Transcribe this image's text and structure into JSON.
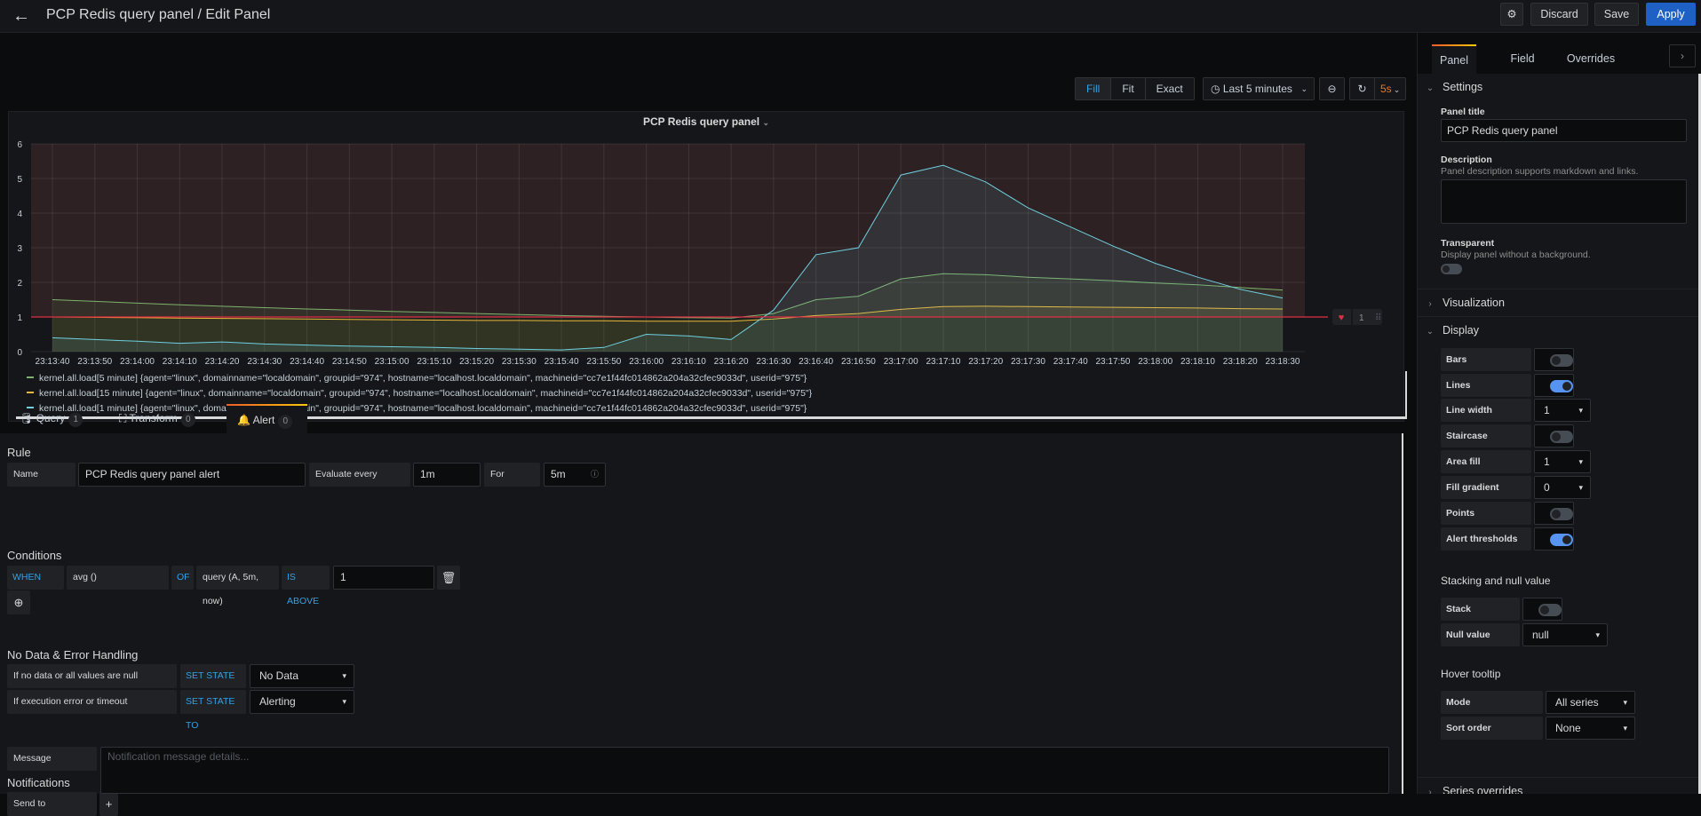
{
  "header": {
    "title": "PCP Redis query panel / Edit Panel",
    "discard_label": "Discard",
    "save_label": "Save",
    "apply_label": "Apply"
  },
  "toolbar": {
    "modes": [
      "Fill",
      "Fit",
      "Exact"
    ],
    "active_mode": "Fill",
    "time_range": "Last 5 minutes",
    "refresh_interval": "5s"
  },
  "panel": {
    "title": "PCP Redis query panel"
  },
  "chart_data": {
    "type": "area",
    "title": "PCP Redis query panel",
    "xlabel": "",
    "ylabel": "",
    "ylim": [
      0,
      6
    ],
    "yticks": [
      "0",
      "1",
      "2",
      "3",
      "4",
      "5",
      "6"
    ],
    "x": [
      "23:13:40",
      "23:13:50",
      "23:14:00",
      "23:14:10",
      "23:14:20",
      "23:14:30",
      "23:14:40",
      "23:14:50",
      "23:15:00",
      "23:15:10",
      "23:15:20",
      "23:15:30",
      "23:15:40",
      "23:15:50",
      "23:16:00",
      "23:16:10",
      "23:16:20",
      "23:16:30",
      "23:16:40",
      "23:16:50",
      "23:17:00",
      "23:17:10",
      "23:17:20",
      "23:17:30",
      "23:17:40",
      "23:17:50",
      "23:18:00",
      "23:18:10",
      "23:18:20",
      "23:18:30"
    ],
    "grid": true,
    "threshold": {
      "value": 1,
      "op": "gt",
      "color": "#e02f44"
    },
    "series": [
      {
        "name": "kernel.all.load[5 minute] {agent=\"linux\", domainname=\"localdomain\", groupid=\"974\", hostname=\"localhost.localdomain\", machineid=\"cc7e1f44fc014862a204a32cfec9033d\", userid=\"975\"}",
        "color": "#7eb26d",
        "values": [
          1.5,
          1.45,
          1.4,
          1.35,
          1.31,
          1.27,
          1.23,
          1.2,
          1.16,
          1.13,
          1.1,
          1.07,
          1.04,
          1.02,
          1.0,
          0.98,
          0.97,
          1.1,
          1.5,
          1.6,
          2.1,
          2.25,
          2.22,
          2.15,
          2.1,
          2.05,
          1.98,
          1.93,
          1.85,
          1.78
        ]
      },
      {
        "name": "kernel.all.load[15 minute] {agent=\"linux\", domainname=\"localdomain\", groupid=\"974\", hostname=\"localhost.localdomain\", machineid=\"cc7e1f44fc014862a204a32cfec9033d\", userid=\"975\"}",
        "color": "#eab839",
        "values": [
          1.0,
          0.99,
          0.98,
          0.97,
          0.96,
          0.95,
          0.94,
          0.93,
          0.92,
          0.91,
          0.9,
          0.9,
          0.89,
          0.89,
          0.88,
          0.88,
          0.88,
          0.94,
          1.04,
          1.1,
          1.22,
          1.3,
          1.31,
          1.3,
          1.29,
          1.28,
          1.27,
          1.26,
          1.24,
          1.23
        ]
      },
      {
        "name": "kernel.all.load[1 minute] {agent=\"linux\", domainname=\"localdomain\", groupid=\"974\", hostname=\"localhost.localdomain\", machineid=\"cc7e1f44fc014862a204a32cfec9033d\", userid=\"975\"}",
        "color": "#6ed0e0",
        "values": [
          0.4,
          0.35,
          0.3,
          0.24,
          0.28,
          0.22,
          0.19,
          0.16,
          0.14,
          0.12,
          0.09,
          0.07,
          0.05,
          0.12,
          0.5,
          0.45,
          0.35,
          1.2,
          2.8,
          3.0,
          5.1,
          5.38,
          4.9,
          4.15,
          3.6,
          3.05,
          2.55,
          2.15,
          1.8,
          1.55
        ]
      }
    ]
  },
  "threshold_handle": {
    "value": "1"
  },
  "editor_tabs": [
    {
      "label": "Query",
      "count": "1"
    },
    {
      "label": "Transform",
      "count": "0"
    },
    {
      "label": "Alert",
      "count": "0"
    }
  ],
  "alert": {
    "rule_title": "Rule",
    "name_label": "Name",
    "name_value": "PCP Redis query panel alert",
    "evaluate_label": "Evaluate every",
    "evaluate_value": "1m",
    "for_label": "For",
    "for_value": "5m",
    "conditions_title": "Conditions",
    "when_label": "WHEN",
    "reducer": "avg ()",
    "of_label": "OF",
    "query": "query (A, 5m, now)",
    "evaluator": "IS ABOVE",
    "threshold": "1",
    "nodata_title": "No Data & Error Handling",
    "nodata_label": "If no data or all values are null",
    "set_state_label": "SET STATE TO",
    "nodata_value": "No Data",
    "error_label": "If execution error or timeout",
    "error_value": "Alerting",
    "notifications_title": "Notifications",
    "send_to_label": "Send to",
    "message_label": "Message",
    "message_placeholder": "Notification message details..."
  },
  "options": {
    "tabs": [
      "Panel",
      "Field",
      "Overrides"
    ],
    "settings_title": "Settings",
    "panel_title_label": "Panel title",
    "panel_title_value": "PCP Redis query panel",
    "description_label": "Description",
    "description_hint": "Panel description supports markdown and links.",
    "transparent_label": "Transparent",
    "transparent_hint": "Display panel without a background.",
    "transparent": false,
    "visualization_title": "Visualization",
    "display_title": "Display",
    "display": {
      "bars_label": "Bars",
      "bars": false,
      "lines_label": "Lines",
      "lines": true,
      "line_width_label": "Line width",
      "line_width": "1",
      "staircase_label": "Staircase",
      "staircase": false,
      "area_fill_label": "Area fill",
      "area_fill": "1",
      "fill_gradient_label": "Fill gradient",
      "fill_gradient": "0",
      "points_label": "Points",
      "points": false,
      "alert_thresholds_label": "Alert thresholds",
      "alert_thresholds": true
    },
    "stacking_title": "Stacking and null value",
    "stack_label": "Stack",
    "stack": false,
    "null_value_label": "Null value",
    "null_value": "null",
    "tooltip_title": "Hover tooltip",
    "mode_label": "Mode",
    "mode": "All series",
    "sort_label": "Sort order",
    "sort": "None",
    "series_overrides_title": "Series overrides"
  }
}
